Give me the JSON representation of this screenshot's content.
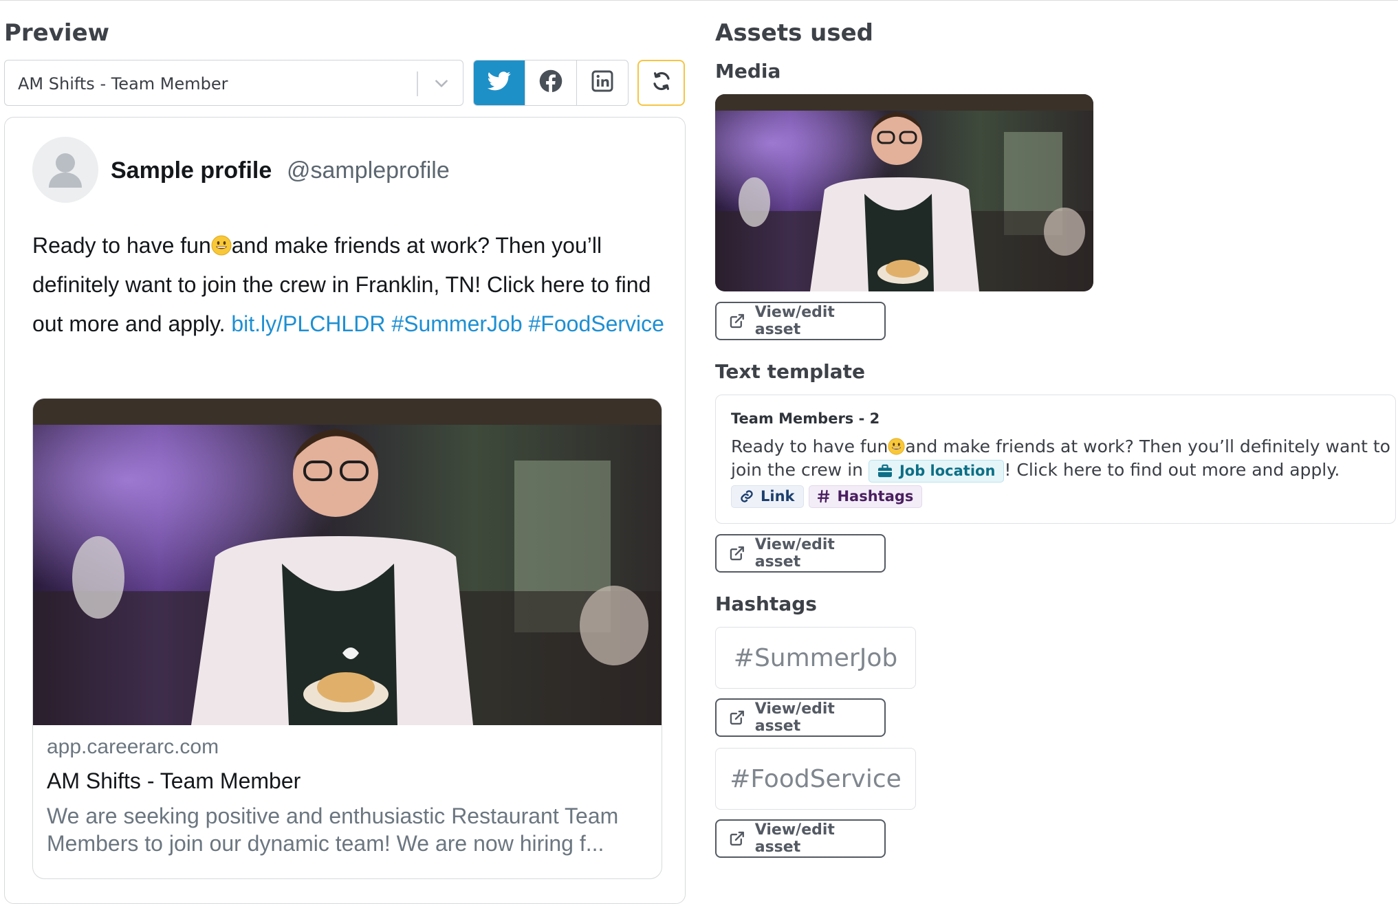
{
  "preview": {
    "title": "Preview",
    "job_select": {
      "value": "AM Shifts - Team Member"
    },
    "networks": [
      {
        "name": "twitter-icon",
        "active": true,
        "active_color": "#1e90c8"
      },
      {
        "name": "facebook-icon",
        "active": false
      },
      {
        "name": "linkedin-icon",
        "active": false
      }
    ],
    "refresh_icon": "refresh-icon",
    "post": {
      "profile_name": "Sample profile",
      "handle": "@sampleprofile",
      "text_1": "Ready to have fun",
      "emoji": "grinning-face-emoji",
      "text_2": "and make friends at work? Then you’ll definitely want to join the crew in Franklin, TN! Click here to find out more and apply.",
      "link": "bit.ly/PLCHLDR",
      "hashtag_1": "#SummerJob",
      "hashtag_2": "#FoodService",
      "link_card": {
        "domain": "app.careerarc.com",
        "title": "AM Shifts - Team Member",
        "description": "We are seeking positive and enthusiastic Restaurant Team Members to join our dynamic team! We are now hiring f..."
      }
    }
  },
  "assets": {
    "title": "Assets used",
    "media": {
      "title": "Media",
      "button_label": "View/edit asset"
    },
    "text_template": {
      "title": "Text template",
      "name": "Team Members - 2",
      "text_1": "Ready to have fun",
      "text_2": "and make friends at work? Then you’ll definitely want to join the crew in",
      "location_chip": "Job location",
      "text_3": "! Click here to find out more and apply.",
      "link_chip": "Link",
      "hashtags_chip": "Hashtags",
      "button_label": "View/edit asset"
    },
    "hashtags": {
      "title": "Hashtags",
      "items": [
        {
          "tag": "#SummerJob",
          "button_label": "View/edit asset"
        },
        {
          "tag": "#FoodService",
          "button_label": "View/edit asset"
        }
      ]
    }
  },
  "colors": {
    "twitter_blue": "#1e90c8",
    "link_blue": "#1d8fd3",
    "refresh_border": "#f5c544",
    "button_border": "#545a63"
  }
}
